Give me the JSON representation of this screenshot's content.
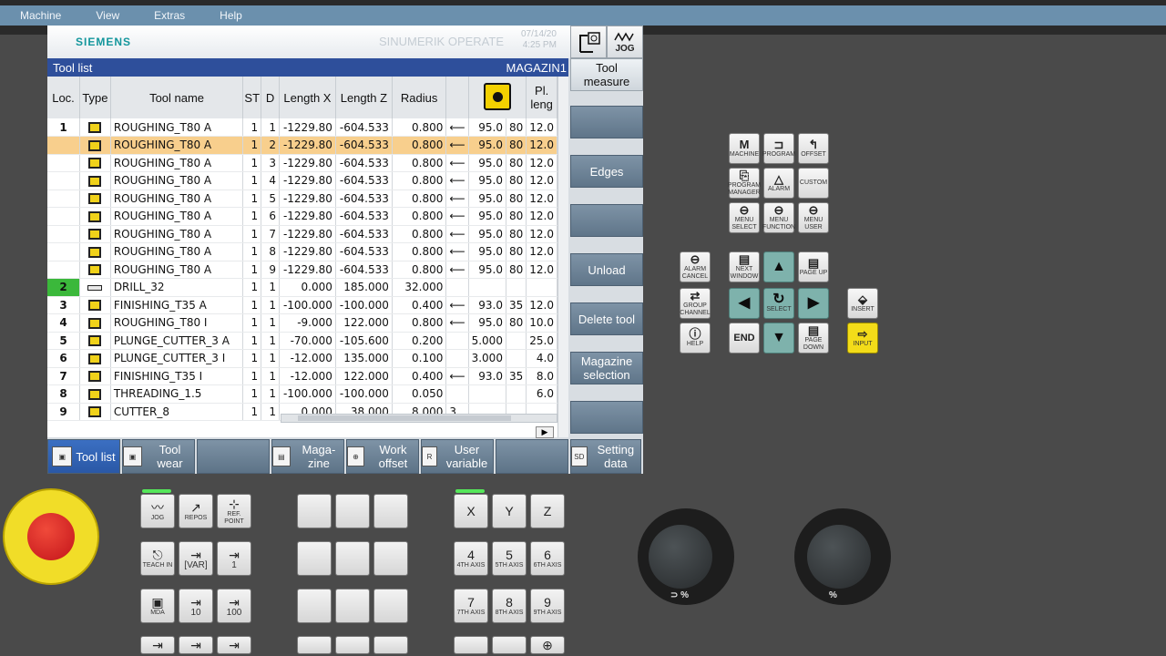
{
  "menu": [
    "Machine",
    "View",
    "Extras",
    "Help"
  ],
  "brand": {
    "siemens": "SIEMENS",
    "product": "SINUMERIK OPERATE",
    "date": "07/14/20",
    "time": "4:25 PM"
  },
  "mode_icons": {
    "jog": "JOG"
  },
  "title": {
    "left": "Tool list",
    "right": "MAGAZIN1"
  },
  "table": {
    "headers": [
      "Loc.",
      "Type",
      "Tool name",
      "ST",
      "D",
      "Length X",
      "Length Z",
      "Radius",
      "",
      "",
      "",
      "Pl. leng"
    ],
    "rows": [
      {
        "loc": "1",
        "name": "ROUGHING_T80 A",
        "st": "1",
        "d": "1",
        "lx": "-1229.80",
        "lz": "-604.533",
        "r": "0.800",
        "dir": "⟵",
        "a": "95.0",
        "b": "80",
        "pl": "12.0"
      },
      {
        "loc": "",
        "name": "ROUGHING_T80 A",
        "st": "1",
        "d": "2",
        "lx": "-1229.80",
        "lz": "-604.533",
        "r": "0.800",
        "dir": "⟵",
        "a": "95.0",
        "b": "80",
        "pl": "12.0"
      },
      {
        "loc": "",
        "name": "ROUGHING_T80 A",
        "st": "1",
        "d": "3",
        "lx": "-1229.80",
        "lz": "-604.533",
        "r": "0.800",
        "dir": "⟵",
        "a": "95.0",
        "b": "80",
        "pl": "12.0"
      },
      {
        "loc": "",
        "name": "ROUGHING_T80 A",
        "st": "1",
        "d": "4",
        "lx": "-1229.80",
        "lz": "-604.533",
        "r": "0.800",
        "dir": "⟵",
        "a": "95.0",
        "b": "80",
        "pl": "12.0"
      },
      {
        "loc": "",
        "name": "ROUGHING_T80 A",
        "st": "1",
        "d": "5",
        "lx": "-1229.80",
        "lz": "-604.533",
        "r": "0.800",
        "dir": "⟵",
        "a": "95.0",
        "b": "80",
        "pl": "12.0"
      },
      {
        "loc": "",
        "name": "ROUGHING_T80 A",
        "st": "1",
        "d": "6",
        "lx": "-1229.80",
        "lz": "-604.533",
        "r": "0.800",
        "dir": "⟵",
        "a": "95.0",
        "b": "80",
        "pl": "12.0"
      },
      {
        "loc": "",
        "name": "ROUGHING_T80 A",
        "st": "1",
        "d": "7",
        "lx": "-1229.80",
        "lz": "-604.533",
        "r": "0.800",
        "dir": "⟵",
        "a": "95.0",
        "b": "80",
        "pl": "12.0"
      },
      {
        "loc": "",
        "name": "ROUGHING_T80 A",
        "st": "1",
        "d": "8",
        "lx": "-1229.80",
        "lz": "-604.533",
        "r": "0.800",
        "dir": "⟵",
        "a": "95.0",
        "b": "80",
        "pl": "12.0"
      },
      {
        "loc": "",
        "name": "ROUGHING_T80 A",
        "st": "1",
        "d": "9",
        "lx": "-1229.80",
        "lz": "-604.533",
        "r": "0.800",
        "dir": "⟵",
        "a": "95.0",
        "b": "80",
        "pl": "12.0"
      },
      {
        "loc": "2",
        "name": "DRILL_32",
        "st": "1",
        "d": "1",
        "lx": "0.000",
        "lz": "185.000",
        "r": "32.000",
        "dir": "",
        "a": "",
        "b": "",
        "pl": ""
      },
      {
        "loc": "3",
        "name": "FINISHING_T35 A",
        "st": "1",
        "d": "1",
        "lx": "-100.000",
        "lz": "-100.000",
        "r": "0.400",
        "dir": "⟵",
        "a": "93.0",
        "b": "35",
        "pl": "12.0"
      },
      {
        "loc": "4",
        "name": "ROUGHING_T80 I",
        "st": "1",
        "d": "1",
        "lx": "-9.000",
        "lz": "122.000",
        "r": "0.800",
        "dir": "⟵",
        "a": "95.0",
        "b": "80",
        "pl": "10.0"
      },
      {
        "loc": "5",
        "name": "PLUNGE_CUTTER_3 A",
        "st": "1",
        "d": "1",
        "lx": "-70.000",
        "lz": "-105.600",
        "r": "0.200",
        "dir": "",
        "a": "5.000",
        "b": "",
        "pl": "25.0"
      },
      {
        "loc": "6",
        "name": "PLUNGE_CUTTER_3 I",
        "st": "1",
        "d": "1",
        "lx": "-12.000",
        "lz": "135.000",
        "r": "0.100",
        "dir": "",
        "a": "3.000",
        "b": "",
        "pl": "4.0"
      },
      {
        "loc": "7",
        "name": "FINISHING_T35 I",
        "st": "1",
        "d": "1",
        "lx": "-12.000",
        "lz": "122.000",
        "r": "0.400",
        "dir": "⟵",
        "a": "93.0",
        "b": "35",
        "pl": "8.0"
      },
      {
        "loc": "8",
        "name": "THREADING_1.5",
        "st": "1",
        "d": "1",
        "lx": "-100.000",
        "lz": "-100.000",
        "r": "0.050",
        "dir": "",
        "a": "",
        "b": "",
        "pl": "6.0"
      },
      {
        "loc": "9",
        "name": "CUTTER_8",
        "st": "1",
        "d": "1",
        "lx": "0.000",
        "lz": "38.000",
        "r": "8.000",
        "dir": "3",
        "a": "",
        "b": "",
        "pl": ""
      }
    ]
  },
  "vertical_softkeys": [
    "Tool measure",
    "",
    "Edges",
    "",
    "Unload",
    "Delete tool",
    "Magazine selection",
    ""
  ],
  "horizontal_softkeys": [
    {
      "label": "Tool list",
      "icon": "tool-list-icon"
    },
    {
      "label": "Tool wear",
      "icon": "tool-wear-icon"
    },
    {
      "label": "",
      "icon": ""
    },
    {
      "label": "Maga-zine",
      "icon": "magazine-icon"
    },
    {
      "label": "Work offset",
      "icon": "work-offset-icon"
    },
    {
      "label": "User variable",
      "icon": "user-variable-icon"
    },
    {
      "label": "",
      "icon": ""
    },
    {
      "label": "Setting data",
      "icon": "setting-data-icon"
    }
  ],
  "keypad": {
    "machine": "MACHINE",
    "program": "PROGRAM",
    "offset": "OFFSET",
    "program_manager": "PROGRAM MANAGER",
    "alarm": "ALARM",
    "custom": "CUSTOM",
    "menu_select": "MENU SELECT",
    "menu_function": "MENU FUNCTION",
    "menu_user": "MENU USER",
    "alarm_cancel": "ALARM CANCEL",
    "next_window": "NEXT WINDOW",
    "page_up": "PAGE UP",
    "group_channel": "GROUP CHANNEL",
    "select": "SELECT",
    "insert": "INSERT",
    "help": "HELP",
    "end": "END",
    "page_down": "PAGE DOWN",
    "input": "INPUT"
  },
  "panel": {
    "jog": "JOG",
    "repos": "REPOS",
    "ref_point": "REF. POINT",
    "teach_in": "TEACH IN",
    "var": "[VAR]",
    "inc1": "1",
    "mda": "MDA",
    "inc10": "10",
    "inc100": "100",
    "x": "X",
    "y": "Y",
    "z": "Z",
    "axis4": "4",
    "axis4_sub": "4TH AXIS",
    "axis5": "5",
    "axis5_sub": "5TH AXIS",
    "axis6": "6",
    "axis6_sub": "6TH AXIS",
    "axis7": "7",
    "axis7_sub": "7TH AXIS",
    "axis8": "8",
    "axis8_sub": "8TH AXIS",
    "axis9": "9",
    "axis9_sub": "9TH AXIS"
  },
  "dials": {
    "feed_label": "⊃ %",
    "spindle_label": "%"
  }
}
